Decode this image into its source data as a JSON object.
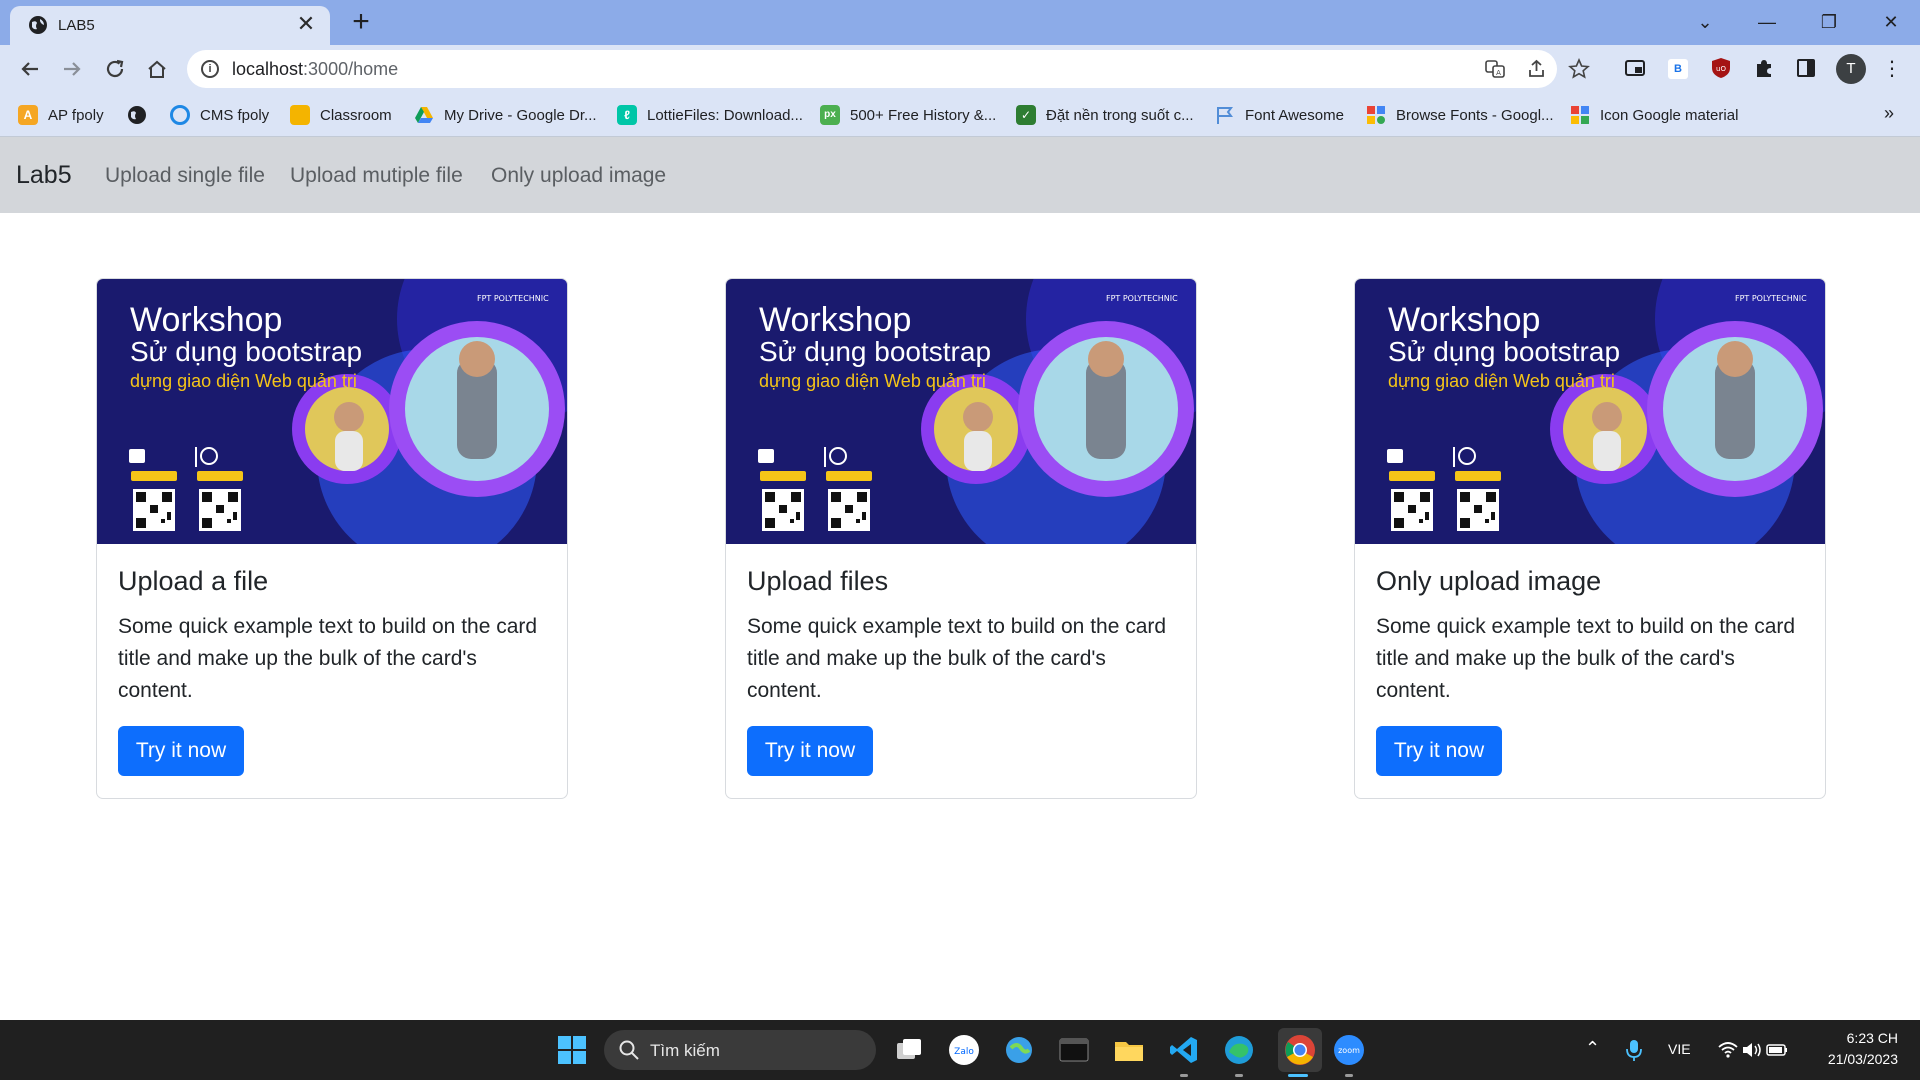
{
  "browser": {
    "tab_title": "LAB5",
    "tab_close": "✕",
    "new_tab": "+",
    "url_scheme_host": "localhost",
    "url_rest": ":3000/home",
    "avatar_letter": "T",
    "window_controls": [
      "⌄",
      "—",
      "❐",
      "✕"
    ]
  },
  "bookmarks": [
    {
      "label": "AP fpoly",
      "icon": "ap-fpoly-icon",
      "color": "#f5a623"
    },
    {
      "label": "",
      "icon": "globe-icon",
      "color": "#202124"
    },
    {
      "label": "CMS fpoly",
      "icon": "cms-icon",
      "color": "#1e88e5"
    },
    {
      "label": "Classroom",
      "icon": "classroom-icon",
      "color": "#f4b400"
    },
    {
      "label": "My Drive - Google Dr...",
      "icon": "drive-icon",
      "color": "#0f9d58"
    },
    {
      "label": "LottieFiles: Download...",
      "icon": "lottie-icon",
      "color": "#00c6a7"
    },
    {
      "label": "500+ Free History &...",
      "icon": "px-icon",
      "color": "#4caf50"
    },
    {
      "label": "Đặt nền trong suốt c...",
      "icon": "tool-icon",
      "color": "#2e7d32"
    },
    {
      "label": "Font Awesome",
      "icon": "flag-icon",
      "color": "#528dd7"
    },
    {
      "label": "Browse Fonts - Googl...",
      "icon": "google-fonts-icon",
      "color": "#ea4335"
    },
    {
      "label": "Icon Google material",
      "icon": "material-icon",
      "color": "#ea4335"
    }
  ],
  "bookmarks_more": "»",
  "navbar": {
    "brand": "Lab5",
    "links": [
      "Upload single file",
      "Upload mutiple file",
      "Only upload image"
    ]
  },
  "poster": {
    "line1": "Workshop",
    "line2": "Sử dụng bootstrap",
    "line3": "dựng giao diện Web quản trị"
  },
  "cards": [
    {
      "title": "Upload a file",
      "text": "Some quick example text to build on the card title and make up the bulk of the card's content.",
      "button": "Try it now"
    },
    {
      "title": "Upload files",
      "text": "Some quick example text to build on the card title and make up the bulk of the card's content.",
      "button": "Try it now"
    },
    {
      "title": "Only upload image",
      "text": "Some quick example text to build on the card title and make up the bulk of the card's content.",
      "button": "Try it now"
    }
  ],
  "taskbar": {
    "search_placeholder": "Tìm kiếm",
    "language": "VIE",
    "time": "6:23 CH",
    "date": "21/03/2023"
  },
  "colors": {
    "primary_button": "#0d6efd",
    "tab_strip": "#8cabe8",
    "toolbar": "#dbe4f6",
    "navbar": "#d3d6da",
    "poster_bg": "#1a1a6e",
    "taskbar": "#202020"
  }
}
